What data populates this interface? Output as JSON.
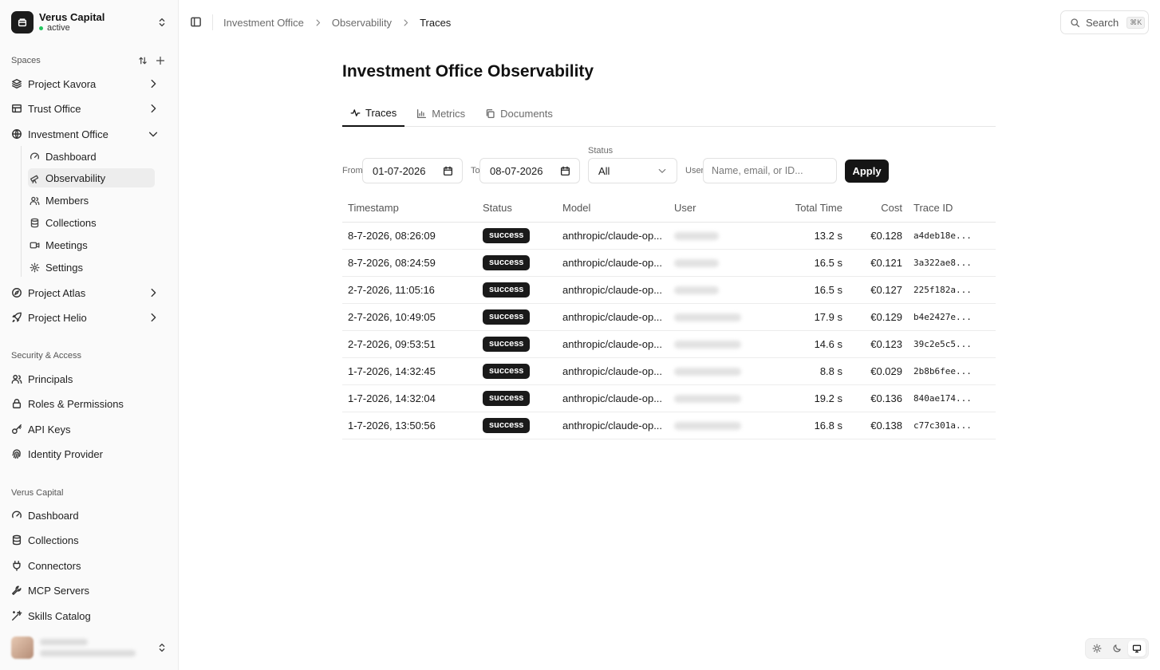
{
  "org": {
    "name": "Verus Capital",
    "status": "active"
  },
  "sidebar": {
    "spaces_label": "Spaces",
    "spaces": [
      {
        "label": "Project Kavora",
        "icon": "layers-icon"
      },
      {
        "label": "Trust Office",
        "icon": "building-icon"
      },
      {
        "label": "Investment Office",
        "icon": "globe-icon",
        "expanded": true
      },
      {
        "label": "Project Atlas",
        "icon": "compass-icon"
      },
      {
        "label": "Project Helio",
        "icon": "rocket-icon"
      }
    ],
    "investment_children": [
      {
        "label": "Dashboard",
        "icon": "gauge-icon"
      },
      {
        "label": "Observability",
        "icon": "telescope-icon",
        "active": true
      },
      {
        "label": "Members",
        "icon": "users-icon"
      },
      {
        "label": "Collections",
        "icon": "database-icon"
      },
      {
        "label": "Meetings",
        "icon": "video-icon"
      },
      {
        "label": "Settings",
        "icon": "gear-icon"
      }
    ],
    "security_label": "Security & Access",
    "security": [
      {
        "label": "Principals",
        "icon": "users-icon"
      },
      {
        "label": "Roles & Permissions",
        "icon": "lock-icon"
      },
      {
        "label": "API Keys",
        "icon": "key-icon"
      },
      {
        "label": "Identity Provider",
        "icon": "fingerprint-icon"
      }
    ],
    "org_label": "Verus Capital",
    "org_items": [
      {
        "label": "Dashboard",
        "icon": "gauge-icon"
      },
      {
        "label": "Collections",
        "icon": "database-icon"
      },
      {
        "label": "Connectors",
        "icon": "plug-icon"
      },
      {
        "label": "MCP Servers",
        "icon": "wrench-icon"
      },
      {
        "label": "Skills Catalog",
        "icon": "wand-icon"
      }
    ]
  },
  "breadcrumb": [
    "Investment Office",
    "Observability",
    "Traces"
  ],
  "search": {
    "label": "Search",
    "shortcut": "⌘K"
  },
  "page": {
    "title": "Investment Office Observability"
  },
  "tabs": [
    {
      "label": "Traces",
      "icon": "activity-icon",
      "active": true
    },
    {
      "label": "Metrics",
      "icon": "bar-chart-icon"
    },
    {
      "label": "Documents",
      "icon": "copy-icon"
    }
  ],
  "filters": {
    "from_label": "From",
    "from_value": "01-07-2026",
    "to_label": "To",
    "to_value": "08-07-2026",
    "status_label": "Status",
    "status_value": "All",
    "user_label": "User",
    "user_placeholder": "Name, email, or ID...",
    "apply_label": "Apply"
  },
  "table": {
    "columns": [
      "Timestamp",
      "Status",
      "Model",
      "User",
      "Total Time",
      "Cost",
      "Trace ID"
    ],
    "rows": [
      {
        "timestamp": "8-7-2026, 08:26:09",
        "status": "success",
        "model": "anthropic/claude-op...",
        "total_time": "13.2 s",
        "cost": "€0.128",
        "trace_id": "a4deb18e..."
      },
      {
        "timestamp": "8-7-2026, 08:24:59",
        "status": "success",
        "model": "anthropic/claude-op...",
        "total_time": "16.5 s",
        "cost": "€0.121",
        "trace_id": "3a322ae8..."
      },
      {
        "timestamp": "2-7-2026, 11:05:16",
        "status": "success",
        "model": "anthropic/claude-op...",
        "total_time": "16.5 s",
        "cost": "€0.127",
        "trace_id": "225f182a..."
      },
      {
        "timestamp": "2-7-2026, 10:49:05",
        "status": "success",
        "model": "anthropic/claude-op...",
        "total_time": "17.9 s",
        "cost": "€0.129",
        "trace_id": "b4e2427e..."
      },
      {
        "timestamp": "2-7-2026, 09:53:51",
        "status": "success",
        "model": "anthropic/claude-op...",
        "total_time": "14.6 s",
        "cost": "€0.123",
        "trace_id": "39c2e5c5..."
      },
      {
        "timestamp": "1-7-2026, 14:32:45",
        "status": "success",
        "model": "anthropic/claude-op...",
        "total_time": "8.8 s",
        "cost": "€0.029",
        "trace_id": "2b8b6fee..."
      },
      {
        "timestamp": "1-7-2026, 14:32:04",
        "status": "success",
        "model": "anthropic/claude-op...",
        "total_time": "19.2 s",
        "cost": "€0.136",
        "trace_id": "840ae174..."
      },
      {
        "timestamp": "1-7-2026, 13:50:56",
        "status": "success",
        "model": "anthropic/claude-op...",
        "total_time": "16.8 s",
        "cost": "€0.138",
        "trace_id": "c77c301a..."
      }
    ]
  },
  "theme": {
    "options": [
      "sun-icon",
      "moon-icon",
      "monitor-icon"
    ],
    "selected": "monitor-icon"
  },
  "colors": {
    "accent": "#151515",
    "status_dot": "#22c55e",
    "badge_bg": "#1a1a1a"
  }
}
